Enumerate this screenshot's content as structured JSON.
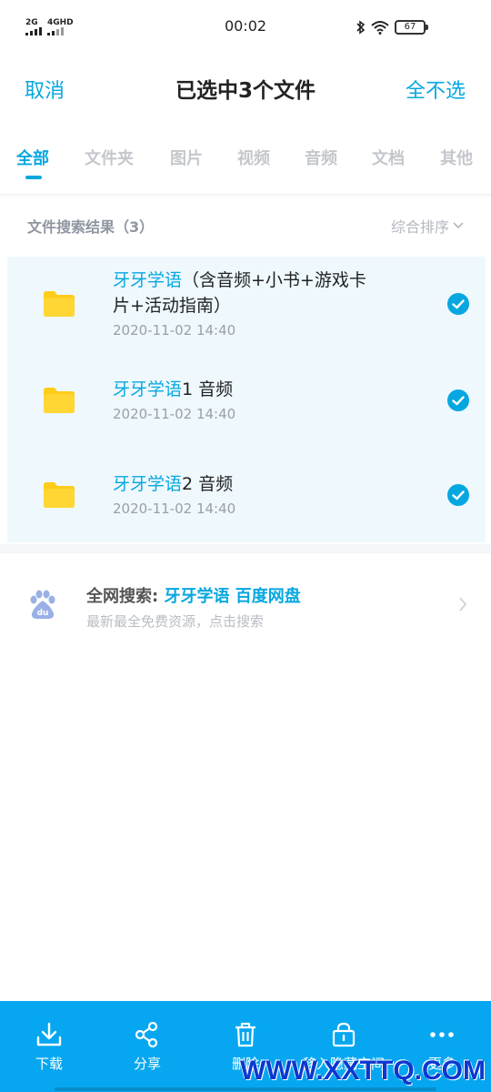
{
  "status": {
    "signal1": "2G",
    "signal2": "4GHD",
    "time": "00:02",
    "battery": "67"
  },
  "header": {
    "cancel_label": "取消",
    "title": "已选中3个文件",
    "deselect_label": "全不选"
  },
  "tabs": [
    {
      "label": "全部",
      "active": true
    },
    {
      "label": "文件夹",
      "active": false
    },
    {
      "label": "图片",
      "active": false
    },
    {
      "label": "视频",
      "active": false
    },
    {
      "label": "音频",
      "active": false
    },
    {
      "label": "文档",
      "active": false
    },
    {
      "label": "其他",
      "active": false
    }
  ],
  "results": {
    "count_label": "文件搜索结果（3）",
    "sort_label": "综合排序"
  },
  "files": [
    {
      "highlight": "牙牙学语",
      "rest_line1": "（含音频+小书+游戏卡",
      "rest_line2": "片+活动指南）",
      "date": "2020-11-02 14:40",
      "selected": true
    },
    {
      "highlight": "牙牙学语",
      "rest_line1": "1 音频",
      "rest_line2": "",
      "date": "2020-11-02 14:40",
      "selected": true
    },
    {
      "highlight": "牙牙学语",
      "rest_line1": "2 音频",
      "rest_line2": "",
      "date": "2020-11-02 14:40",
      "selected": true
    }
  ],
  "web_search": {
    "prefix": "全网搜索: ",
    "highlight": "牙牙学语 百度网盘",
    "subtitle": "最新最全免费资源，点击搜索"
  },
  "toolbar": {
    "download_label": "下载",
    "share_label": "分享",
    "delete_label": "删除",
    "private_label": "移入隐藏空间",
    "more_label": "更多"
  },
  "watermark": "WWW.XXTTQ.COM",
  "colors": {
    "accent": "#06a7e0",
    "toolbar": "#06a7f0",
    "folder": "#ffcc1a",
    "selected_bg": "#eef8fd"
  }
}
